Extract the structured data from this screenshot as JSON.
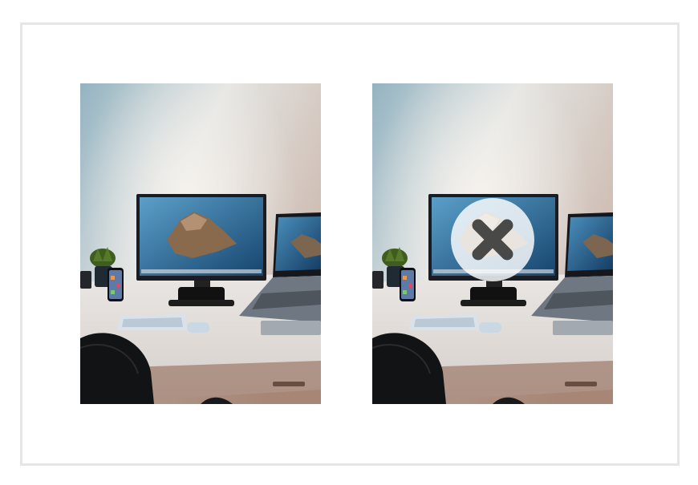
{
  "gallery": {
    "images": [
      {
        "subject": "desk-setup-photo",
        "state": "normal"
      },
      {
        "subject": "desk-setup-photo",
        "state": "marked-for-removal"
      }
    ],
    "remove_control": {
      "icon": "close-icon",
      "color": "#2e2e2e"
    }
  },
  "colors": {
    "frame_border": "#e6e6e6",
    "overlay": "#ffffff"
  }
}
